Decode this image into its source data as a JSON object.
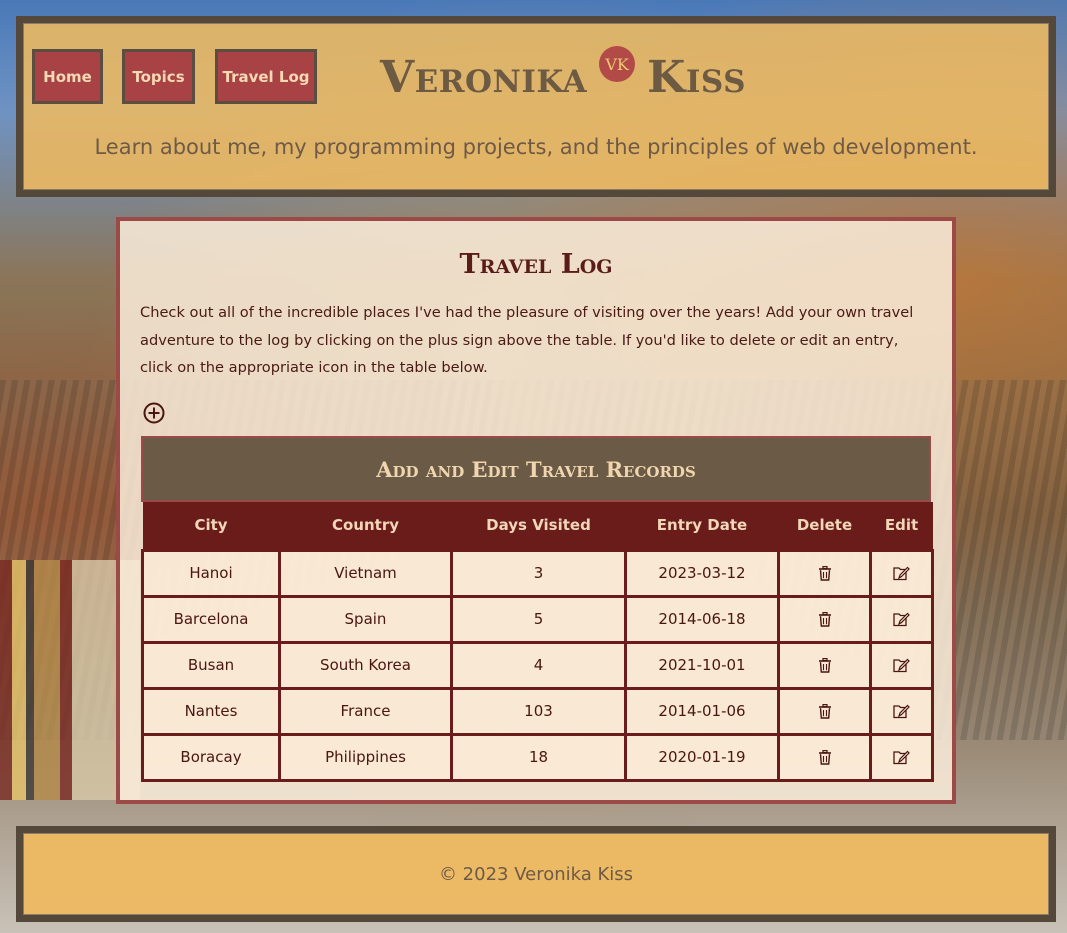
{
  "nav": {
    "home": "Home",
    "topics": "Topics",
    "travel_log": "Travel Log"
  },
  "brand": {
    "first_name": "Veronika",
    "logo_initials": "VK",
    "last_name": "Kiss"
  },
  "header": {
    "tagline": "Learn about me, my programming projects, and the principles of web development."
  },
  "main": {
    "title": "Travel Log",
    "intro": "Check out all of the incredible places I've had the pleasure of visiting over the years! Add your own travel adventure to the log by clicking on the plus sign above the table. If you'd like to delete or edit an entry, click on the appropriate icon in the table below.",
    "add_icon": "plus-circle-icon"
  },
  "table": {
    "caption": "Add and Edit Travel Records",
    "columns": [
      "City",
      "Country",
      "Days Visited",
      "Entry Date",
      "Delete",
      "Edit"
    ],
    "rows": [
      {
        "city": "Hanoi",
        "country": "Vietnam",
        "days": "3",
        "date": "2023-03-12"
      },
      {
        "city": "Barcelona",
        "country": "Spain",
        "days": "5",
        "date": "2014-06-18"
      },
      {
        "city": "Busan",
        "country": "South Korea",
        "days": "4",
        "date": "2021-10-01"
      },
      {
        "city": "Nantes",
        "country": "France",
        "days": "103",
        "date": "2014-01-06"
      },
      {
        "city": "Boracay",
        "country": "Philippines",
        "days": "18",
        "date": "2020-01-19"
      }
    ],
    "delete_icon": "trash-icon",
    "edit_icon": "edit-folder-icon"
  },
  "footer": {
    "text": "© 2023 Veronika Kiss"
  },
  "colors": {
    "header_bg": "#EEBA60",
    "frame": "#54483A",
    "nav_button": "#A84245",
    "table_header": "#6A1C1A",
    "caption_bg": "#6B5A46"
  }
}
